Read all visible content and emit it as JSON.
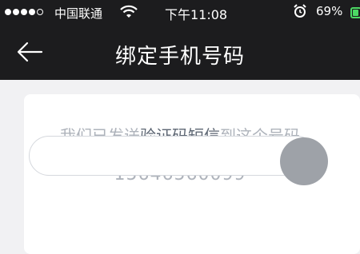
{
  "status_bar": {
    "carrier": "中国联通",
    "time": "下午11:08",
    "battery": "69%",
    "battery_level": 0.69,
    "signal_bars": 4,
    "signal_total": 5
  },
  "nav": {
    "title": "绑定手机号码",
    "back_icon": "arrow-left-icon"
  },
  "card": {
    "sent_prefix": "我们已发送",
    "sent_highlight": "验证码短信",
    "sent_suffix": "到这个号码",
    "phone_number": "15646560099"
  },
  "colors": {
    "header_bg": "#1c1c1e",
    "page_bg": "#f1f1f3",
    "muted_text": "#aeb3bb",
    "highlight_text": "#5d6673",
    "battery_green": "#4cd964"
  }
}
